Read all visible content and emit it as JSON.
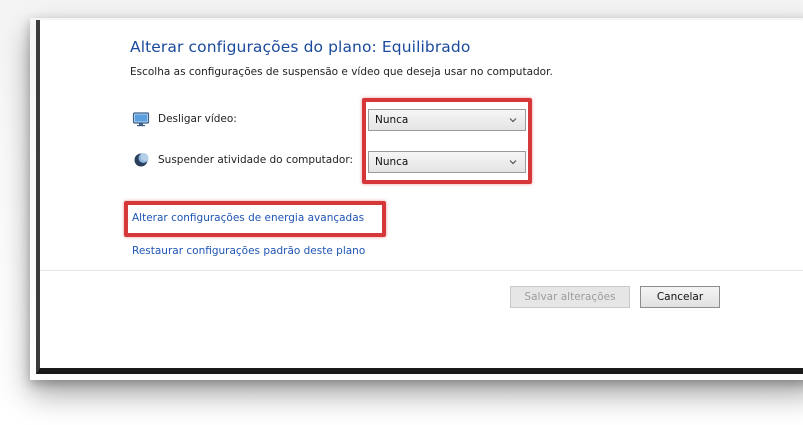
{
  "plan": {
    "title": "Alterar configurações do plano: Equilibrado",
    "subtitle": "Escolha as configurações de suspensão e vídeo que deseja usar no computador."
  },
  "settings": [
    {
      "label": "Desligar vídeo:",
      "value": "Nunca",
      "icon": "monitor-icon"
    },
    {
      "label": "Suspender atividade do computador:",
      "value": "Nunca",
      "icon": "moon-icon"
    }
  ],
  "links": {
    "advanced": "Alterar configurações de energia avançadas",
    "restore": "Restaurar configurações padrão deste plano"
  },
  "buttons": {
    "save": "Salvar alterações",
    "cancel": "Cancelar"
  },
  "colors": {
    "title": "#1a4a9c",
    "link": "#1f55b5",
    "highlight": "#d6383a"
  }
}
